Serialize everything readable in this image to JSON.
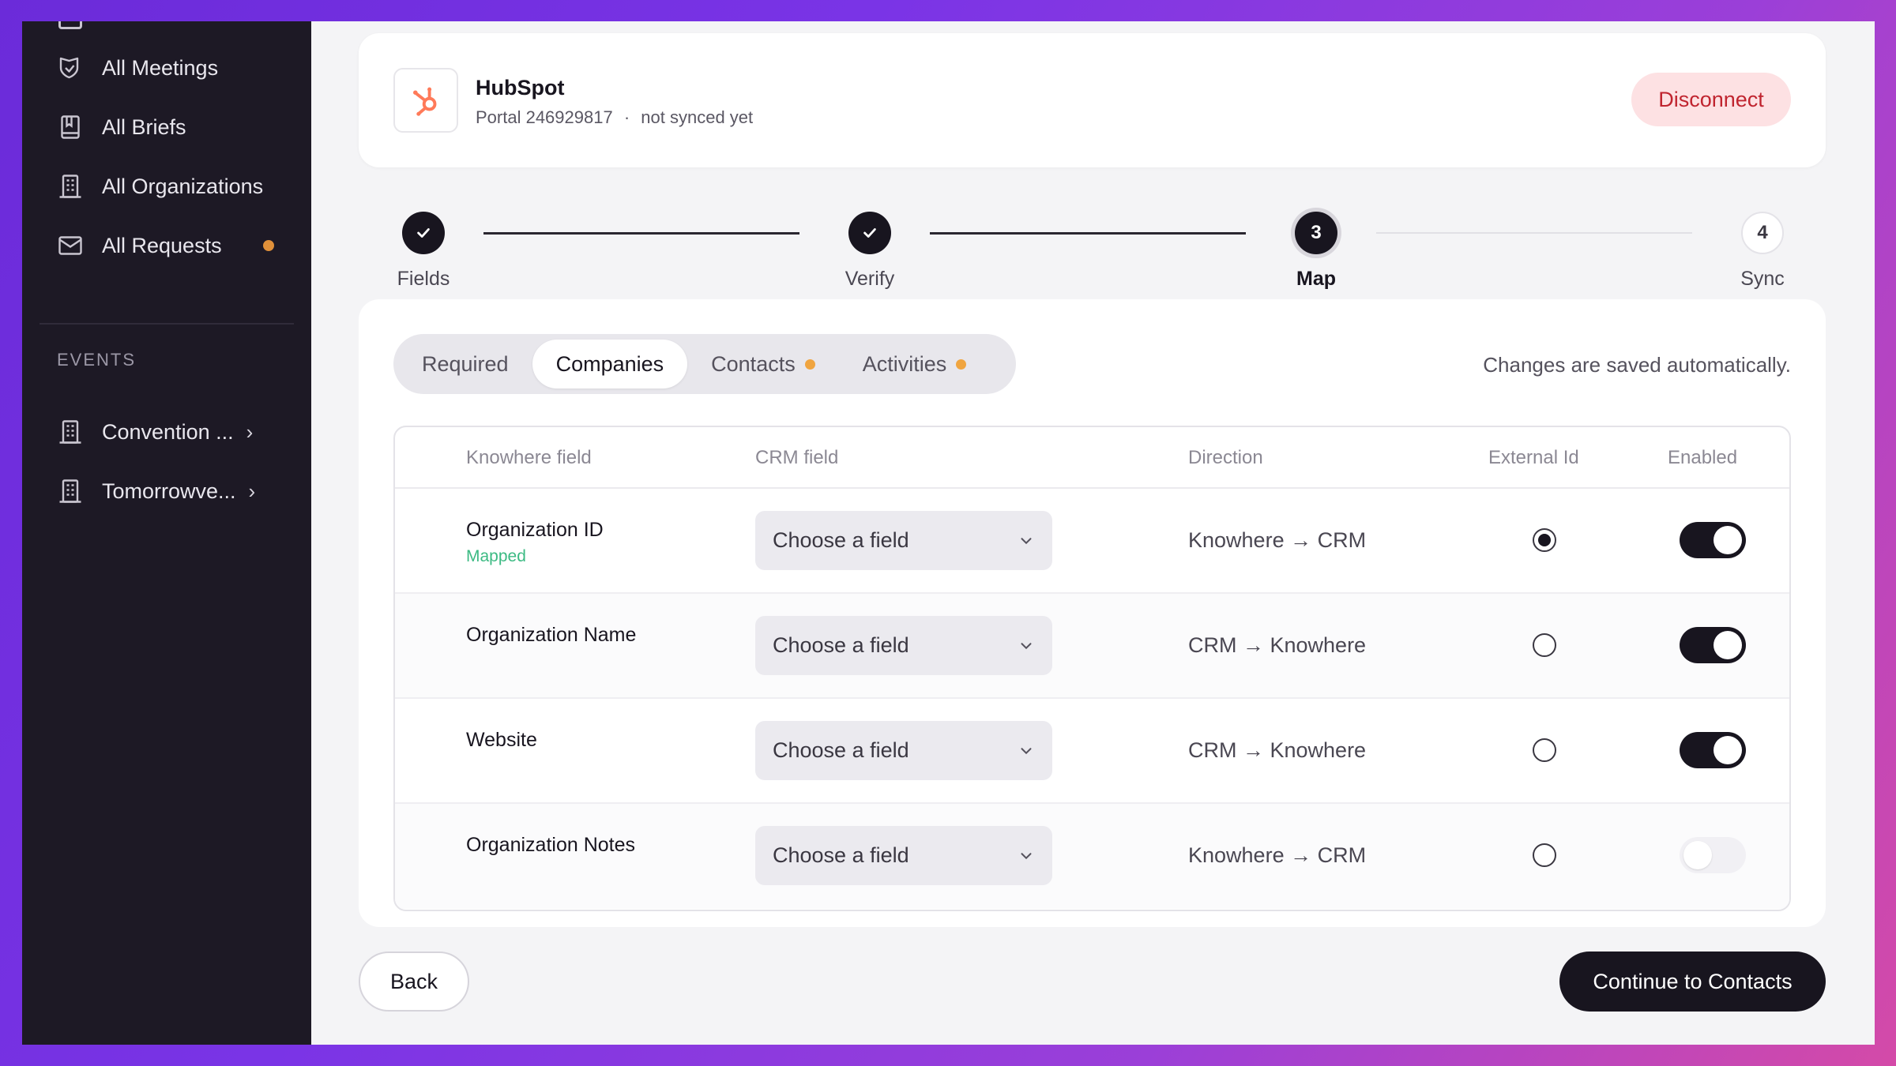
{
  "sidebar": {
    "items": [
      {
        "label": "All Meetings",
        "icon": "handshake-icon"
      },
      {
        "label": "All Briefs",
        "icon": "book-icon"
      },
      {
        "label": "All Organizations",
        "icon": "building-icon"
      },
      {
        "label": "All Requests",
        "icon": "mail-icon",
        "has_dot": true
      }
    ],
    "events_label": "EVENTS",
    "events": [
      {
        "label": "Convention ...",
        "icon": "building-icon"
      },
      {
        "label": "Tomorrowve...",
        "icon": "building-icon"
      }
    ]
  },
  "integration": {
    "name": "HubSpot",
    "portal": "Portal 246929817",
    "separator": "·",
    "status": "not synced yet",
    "disconnect_label": "Disconnect",
    "brand_color": "#ff7a59"
  },
  "stepper": {
    "steps": [
      {
        "number": "1",
        "label": "Fields",
        "state": "done"
      },
      {
        "number": "2",
        "label": "Verify",
        "state": "done"
      },
      {
        "number": "3",
        "label": "Map",
        "state": "active"
      },
      {
        "number": "4",
        "label": "Sync",
        "state": "todo"
      }
    ]
  },
  "tabs": [
    {
      "label": "Required",
      "active": false,
      "dot": false
    },
    {
      "label": "Companies",
      "active": true,
      "dot": false
    },
    {
      "label": "Contacts",
      "active": false,
      "dot": true
    },
    {
      "label": "Activities",
      "active": false,
      "dot": true
    }
  ],
  "saved_note": "Changes are saved automatically.",
  "table": {
    "headers": {
      "knowhere": "Knowhere field",
      "crm": "CRM field",
      "direction": "Direction",
      "external_id": "External Id",
      "enabled": "Enabled"
    },
    "rows": [
      {
        "field": "Organization ID",
        "mapped": "Mapped",
        "crm_placeholder": "Choose a field",
        "direction": "Knowhere → CRM",
        "external_id": true,
        "enabled": true
      },
      {
        "field": "Organization Name",
        "mapped": "",
        "crm_placeholder": "Choose a field",
        "direction": "CRM → Knowhere",
        "external_id": false,
        "enabled": true
      },
      {
        "field": "Website",
        "mapped": "",
        "crm_placeholder": "Choose a field",
        "direction": "CRM → Knowhere",
        "external_id": false,
        "enabled": true
      },
      {
        "field": "Organization Notes",
        "mapped": "",
        "crm_placeholder": "Choose a field",
        "direction": "Knowhere → CRM",
        "external_id": false,
        "enabled": false
      }
    ]
  },
  "footer": {
    "back_label": "Back",
    "continue_label": "Continue to Contacts"
  },
  "colors": {
    "accent_dot": "#f0a540",
    "mapped_green": "#3cba83",
    "dark": "#18151f"
  }
}
